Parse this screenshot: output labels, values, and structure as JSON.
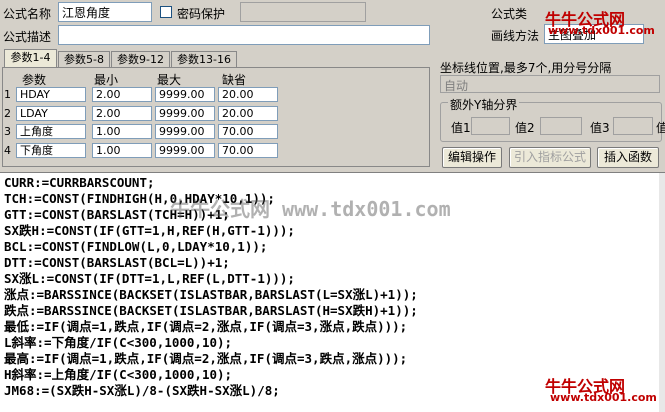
{
  "form": {
    "name_label": "公式名称",
    "name_value": "江恩角度",
    "password_label": "密码保护",
    "desc_label": "公式描述",
    "desc_value": "",
    "type_label": "公式类",
    "draw_label": "画线方法",
    "draw_value": "主图叠加"
  },
  "tabs": [
    "参数1-4",
    "参数5-8",
    "参数9-12",
    "参数13-16"
  ],
  "params": {
    "headers": [
      "参数",
      "最小",
      "最大",
      "缺省"
    ],
    "rows": [
      {
        "n": "1",
        "name": "HDAY",
        "min": "2.00",
        "max": "9999.00",
        "def": "20.00"
      },
      {
        "n": "2",
        "name": "LDAY",
        "min": "2.00",
        "max": "9999.00",
        "def": "20.00"
      },
      {
        "n": "3",
        "name": "上角度",
        "min": "1.00",
        "max": "9999.00",
        "def": "70.00"
      },
      {
        "n": "4",
        "name": "下角度",
        "min": "1.00",
        "max": "9999.00",
        "def": "70.00"
      }
    ]
  },
  "axis": {
    "label": "坐标线位置,最多7个,用分号分隔",
    "value": "自动",
    "extra_title": "额外Y轴分界",
    "val1": "值1",
    "val2": "值2",
    "val3": "值3",
    "val4": "值"
  },
  "buttons": {
    "edit": "编辑操作",
    "import": "引入指标公式",
    "insert": "插入函数"
  },
  "watermark": {
    "site_cn": "牛牛公式网",
    "site_url": "www.tdx001.com",
    "mid": "牛牛公式网  www.tdx001.com"
  },
  "code": [
    "CURR:=CURRBARSCOUNT;",
    "TCH:=CONST(FINDHIGH(H,0,HDAY*10,1));",
    "GTT:=CONST(BARSLAST(TCH=H))+1;",
    "SX跌H:=CONST(IF(GTT=1,H,REF(H,GTT-1)));",
    "BCL:=CONST(FINDLOW(L,0,LDAY*10,1));",
    "DTT:=CONST(BARSLAST(BCL=L))+1;",
    "SX涨L:=CONST(IF(DTT=1,L,REF(L,DTT-1)));",
    "涨点:=BARSSINCE(BACKSET(ISLASTBAR,BARSLAST(L=SX涨L)+1));",
    "跌点:=BARSSINCE(BACKSET(ISLASTBAR,BARSLAST(H=SX跌H)+1));",
    "最低:=IF(调点=1,跌点,IF(调点=2,涨点,IF(调点=3,涨点,跌点)));",
    "L斜率:=下角度/IF(C<300,1000,10);",
    "最高:=IF(调点=1,跌点,IF(调点=2,涨点,IF(调点=3,跌点,涨点)));",
    "H斜率:=上角度/IF(C<300,1000,10);",
    "JM68:=(SX跌H-SX涨L)/8-(SX跌H-SX涨L)/8;"
  ]
}
